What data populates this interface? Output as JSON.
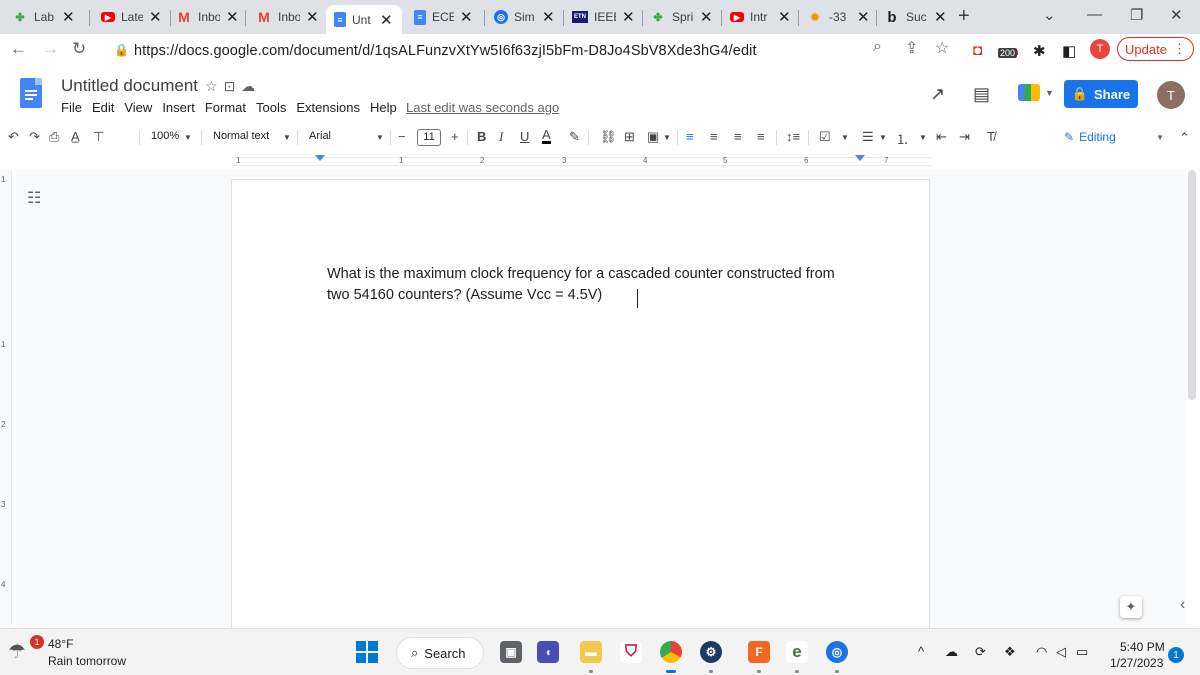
{
  "browser": {
    "tabs": [
      {
        "label": "Lab",
        "icon": "puzzle-icon",
        "color": "#34a853"
      },
      {
        "label": "Late",
        "icon": "youtube-icon",
        "color": "#ff0000"
      },
      {
        "label": "Inbo",
        "icon": "gmail-icon",
        "color": "#ea4335"
      },
      {
        "label": "Inbo",
        "icon": "gmail-icon",
        "color": "#ea4335"
      },
      {
        "label": "Unt",
        "icon": "docs-icon",
        "color": "#4285f4"
      },
      {
        "label": "ECE",
        "icon": "docs-icon",
        "color": "#4285f4"
      },
      {
        "label": "Sim",
        "icon": "globe-icon",
        "color": "#1a73e8"
      },
      {
        "label": "IEEE",
        "icon": "etn-icon",
        "color": "#1a1a6e"
      },
      {
        "label": "Spri",
        "icon": "puzzle-icon",
        "color": "#34a853"
      },
      {
        "label": "Intr",
        "icon": "youtube-icon",
        "color": "#ff0000"
      },
      {
        "label": "-33",
        "icon": "gear-icon",
        "color": "#f29900"
      },
      {
        "label": "Suc",
        "icon": "bing-icon",
        "color": "#202124"
      }
    ],
    "tab_close": "✕",
    "new_tab": "+",
    "url": "https://docs.google.com/document/d/1qsALFunzvXtYw5I6f63zjI5bFm-D8Jo4SbV8Xde3hG4/edit",
    "ext_badge": "200",
    "profile_initial": "T",
    "update_label": "Update"
  },
  "docs": {
    "title": "Untitled document",
    "menu": [
      "File",
      "Edit",
      "View",
      "Insert",
      "Format",
      "Tools",
      "Extensions",
      "Help"
    ],
    "last_edit": "Last edit was seconds ago",
    "share_label": "Share",
    "account_initial": "T",
    "toolbar": {
      "zoom": "100%",
      "style": "Normal text",
      "font": "Arial",
      "font_size": "11",
      "minus": "−",
      "plus": "+",
      "bold": "B",
      "italic": "I",
      "underline": "U",
      "text_color": "A",
      "mode": "Editing"
    },
    "ruler_numbers": [
      "1",
      "1",
      "2",
      "3",
      "4",
      "5",
      "6",
      "7"
    ],
    "vruler_numbers": [
      "1",
      "1",
      "2",
      "3",
      "4"
    ],
    "body_lines": [
      "What is the maximum clock frequency for a cascaded counter constructed from",
      "two 54160 counters? (Assume Vcc = 4.5V)"
    ]
  },
  "taskbar": {
    "weather_badge": "1",
    "temperature": "48°F",
    "weather_desc": "Rain tomorrow",
    "search_label": "Search",
    "time": "5:40 PM",
    "date": "1/27/2023",
    "notification_count": "1",
    "app_badge_f": "F",
    "app_badge_e": "e"
  }
}
